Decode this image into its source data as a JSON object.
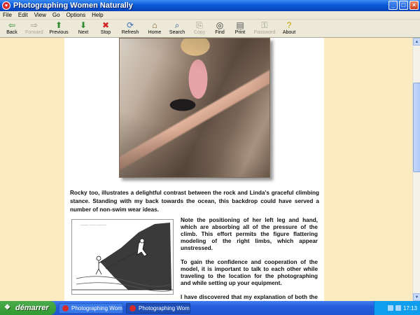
{
  "window": {
    "title": "Photographing Women Naturally",
    "controls": {
      "minimize": "_",
      "maximize": "□",
      "close": "×"
    }
  },
  "menu": [
    "File",
    "Edit",
    "View",
    "Go",
    "Options",
    "Help"
  ],
  "toolbar": [
    {
      "label": "Back",
      "icon": "back-arrow-icon",
      "glyph": "⇦",
      "color": "#2e8b2e",
      "enabled": true
    },
    {
      "label": "Forward",
      "icon": "forward-arrow-icon",
      "glyph": "⇨",
      "color": "#9c9a8e",
      "enabled": false
    },
    {
      "label": "Previous",
      "icon": "up-arrow-icon",
      "glyph": "⬆",
      "color": "#2e8b2e",
      "enabled": true
    },
    {
      "label": "Next",
      "icon": "down-arrow-icon",
      "glyph": "⬇",
      "color": "#2e8b2e",
      "enabled": true
    },
    {
      "label": "Stop",
      "icon": "stop-icon",
      "glyph": "✖",
      "color": "#d12323",
      "enabled": true
    },
    {
      "label": "Refresh",
      "icon": "refresh-icon",
      "glyph": "⟳",
      "color": "#3a6fb8",
      "enabled": true
    },
    {
      "label": "Home",
      "icon": "home-icon",
      "glyph": "⌂",
      "color": "#7a5a2a",
      "enabled": true
    },
    {
      "label": "Search",
      "icon": "search-icon",
      "glyph": "⌕",
      "color": "#2a4f8f",
      "enabled": true
    },
    {
      "label": "Copy",
      "icon": "copy-icon",
      "glyph": "⎘",
      "color": "#9c9a8e",
      "enabled": false
    },
    {
      "label": "Find",
      "icon": "binoculars-icon",
      "glyph": "◎",
      "color": "#333333",
      "enabled": true
    },
    {
      "label": "Print",
      "icon": "printer-icon",
      "glyph": "▤",
      "color": "#555555",
      "enabled": true
    },
    {
      "label": "Password",
      "icon": "key-icon",
      "glyph": "⚿",
      "color": "#9c9a8e",
      "enabled": false
    },
    {
      "label": "About",
      "icon": "help-bulb-icon",
      "glyph": "?",
      "color": "#c9a100",
      "enabled": true
    }
  ],
  "page": {
    "caption": "Rocky too, illustrates a delightful contrast between the rock and Linda's graceful climbing stance. Standing with my back towards the ocean, this backdrop could have served a number of non-swim wear ideas.",
    "paragraphs": [
      "Note the positioning of her left leg and hand, which are absorbing all of the pressure of the climb. This effort permits the figure flattering modeling of the right limbs, which appear unstressed.",
      "To gain the confidence and cooperation of the model, it is important to talk to each other while traveling to the location for the photographing and while setting up your equipment.",
      "I have discovered that my explanation of both the equipment being used and its application to the"
    ]
  },
  "taskbar": {
    "start_label": "démarrer",
    "tasks": [
      {
        "label": "Photographing Wome...",
        "active": false
      },
      {
        "label": "Photographing Wome...",
        "active": true
      }
    ],
    "lang": "FR",
    "clock": "17:13"
  },
  "colors": {
    "page_background": "#fcebc1",
    "paper": "#ffffff",
    "titlebar": "#0a5ad8"
  }
}
